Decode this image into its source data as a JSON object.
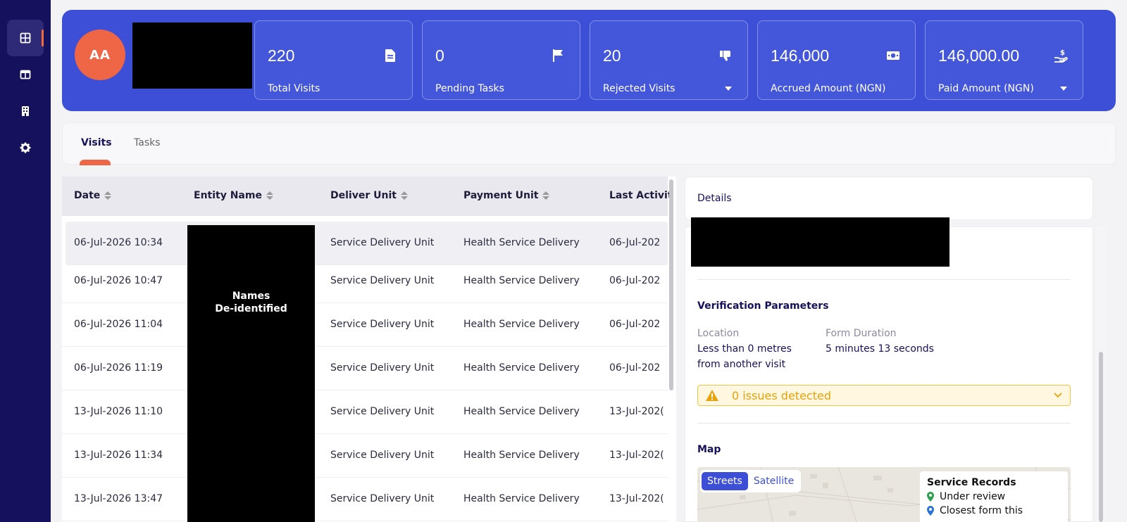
{
  "sidebar": {
    "items": [
      {
        "icon": "dashboard-icon",
        "active": true
      },
      {
        "icon": "columns-icon",
        "active": false
      },
      {
        "icon": "building-icon",
        "active": false
      },
      {
        "icon": "gear-icon",
        "active": false
      }
    ]
  },
  "header": {
    "avatar_initials": "AA",
    "stats": [
      {
        "value": "220",
        "label": "Total Visits",
        "icon": "file-icon",
        "dropdown": false
      },
      {
        "value": "0",
        "label": "Pending Tasks",
        "icon": "flag-icon",
        "dropdown": false
      },
      {
        "value": "20",
        "label": "Rejected Visits",
        "icon": "thumbs-down-icon",
        "dropdown": true
      },
      {
        "value": "146,000",
        "label": "Accrued Amount (NGN)",
        "icon": "money-icon",
        "dropdown": false
      },
      {
        "value": "146,000.00",
        "label": "Paid Amount (NGN)",
        "icon": "hand-dollar-icon",
        "dropdown": true
      }
    ]
  },
  "tabs": [
    {
      "label": "Visits",
      "active": true
    },
    {
      "label": "Tasks",
      "active": false
    }
  ],
  "table": {
    "columns": [
      "Date",
      "Entity Name",
      "Deliver Unit",
      "Payment Unit",
      "Last Activit"
    ],
    "redaction_label_line1": "Names",
    "redaction_label_line2": "De-identified",
    "rows": [
      {
        "date": "06-Jul-2026 10:34",
        "deliver": "Service Delivery Unit",
        "payment": "Health Service Delivery",
        "last": "06-Jul-202"
      },
      {
        "date": "06-Jul-2026 10:47",
        "deliver": "Service Delivery Unit",
        "payment": "Health Service Delivery",
        "last": "06-Jul-202"
      },
      {
        "date": "06-Jul-2026 11:04",
        "deliver": "Service Delivery Unit",
        "payment": "Health Service Delivery",
        "last": "06-Jul-202"
      },
      {
        "date": "06-Jul-2026 11:19",
        "deliver": "Service Delivery Unit",
        "payment": "Health Service Delivery",
        "last": "06-Jul-202"
      },
      {
        "date": "13-Jul-2026 11:10",
        "deliver": "Service Delivery Unit",
        "payment": "Health Service Delivery",
        "last": "13-Jul-202("
      },
      {
        "date": "13-Jul-2026 11:34",
        "deliver": "Service Delivery Unit",
        "payment": "Health Service Delivery",
        "last": "13-Jul-202("
      },
      {
        "date": "13-Jul-2026 13:47",
        "deliver": "Service Delivery Unit",
        "payment": "Health Service Delivery",
        "last": "13-Jul-202("
      }
    ]
  },
  "details": {
    "title": "Details",
    "verification_title": "Verification Parameters",
    "location_label": "Location",
    "location_value": "Less than 0 metres from another visit",
    "duration_label": "Form Duration",
    "duration_value": "5 minutes 13 seconds",
    "issues_text": "0 issues detected",
    "map_title": "Map",
    "map_streets": "Streets",
    "map_satellite": "Satellite",
    "legend_title": "Service Records",
    "legend_item_1": "Under review",
    "legend_item_2": "Closest form this"
  },
  "colors": {
    "brand_dark": "#15115c",
    "header_blue": "#3d4fd6",
    "accent_orange": "#ef6646",
    "warning": "#e8a20c"
  }
}
